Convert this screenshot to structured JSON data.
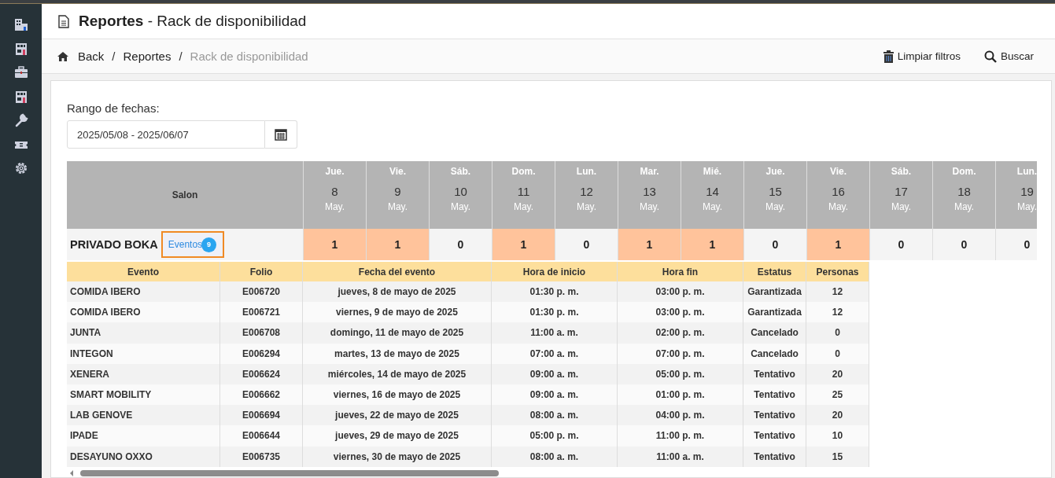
{
  "header": {
    "title_bold": "Reportes",
    "title_rest": "- Rack de disponibilidad"
  },
  "breadcrumb": {
    "items": [
      "Back",
      "Reportes",
      "Rack de disponibilidad"
    ],
    "separator": "/"
  },
  "toolbar": {
    "buttons": [
      {
        "kind": "trash",
        "label": "Limpiar filtros"
      },
      {
        "kind": "search",
        "label": "Buscar"
      }
    ]
  },
  "filter": {
    "label": "Rango de fechas:",
    "value": "2025/05/08 - 2025/06/07"
  },
  "rack": {
    "salon_header": "Salon",
    "days": [
      {
        "weekday": "Jue.",
        "day": "8",
        "month": "May."
      },
      {
        "weekday": "Vie.",
        "day": "9",
        "month": "May."
      },
      {
        "weekday": "Sáb.",
        "day": "10",
        "month": "May."
      },
      {
        "weekday": "Dom.",
        "day": "11",
        "month": "May."
      },
      {
        "weekday": "Lun.",
        "day": "12",
        "month": "May."
      },
      {
        "weekday": "Mar.",
        "day": "13",
        "month": "May."
      },
      {
        "weekday": "Mié.",
        "day": "14",
        "month": "May."
      },
      {
        "weekday": "Jue.",
        "day": "15",
        "month": "May."
      },
      {
        "weekday": "Vie.",
        "day": "16",
        "month": "May."
      },
      {
        "weekday": "Sáb.",
        "day": "17",
        "month": "May."
      },
      {
        "weekday": "Dom.",
        "day": "18",
        "month": "May."
      },
      {
        "weekday": "Lun.",
        "day": "19",
        "month": "May."
      }
    ],
    "salon": {
      "name": "PRIVADO BOKA",
      "events_button": "Eventos",
      "events_count": "9",
      "counts": [
        {
          "value": "1",
          "occupied": true
        },
        {
          "value": "1",
          "occupied": true
        },
        {
          "value": "0",
          "occupied": false
        },
        {
          "value": "1",
          "occupied": true
        },
        {
          "value": "0",
          "occupied": false
        },
        {
          "value": "1",
          "occupied": true
        },
        {
          "value": "1",
          "occupied": true
        },
        {
          "value": "0",
          "occupied": false
        },
        {
          "value": "1",
          "occupied": true
        },
        {
          "value": "0",
          "occupied": false
        },
        {
          "value": "0",
          "occupied": false
        },
        {
          "value": "0",
          "occupied": false
        }
      ]
    }
  },
  "events": {
    "columns": [
      "Evento",
      "Folio",
      "Fecha del evento",
      "Hora de inicio",
      "Hora fin",
      "Estatus",
      "Personas"
    ],
    "rows": [
      [
        "COMIDA IBERO",
        "E006720",
        "jueves, 8 de mayo de 2025",
        "01:30 p. m.",
        "03:00 p. m.",
        "Garantizada",
        "12"
      ],
      [
        "COMIDA IBERO",
        "E006721",
        "viernes, 9 de mayo de 2025",
        "01:30 p. m.",
        "03:00 p. m.",
        "Garantizada",
        "12"
      ],
      [
        "JUNTA",
        "E006708",
        "domingo, 11 de mayo de 2025",
        "11:00 a. m.",
        "02:00 p. m.",
        "Cancelado",
        "0"
      ],
      [
        "INTEGON",
        "E006294",
        "martes, 13 de mayo de 2025",
        "07:00 a. m.",
        "07:00 p. m.",
        "Cancelado",
        "0"
      ],
      [
        "XENERA",
        "E006624",
        "miércoles, 14 de mayo de 2025",
        "09:00 a. m.",
        "05:00 p. m.",
        "Tentativo",
        "20"
      ],
      [
        "SMART MOBILITY",
        "E006662",
        "viernes, 16 de mayo de 2025",
        "09:00 a. m.",
        "01:00 p. m.",
        "Tentativo",
        "25"
      ],
      [
        "LAB GENOVE",
        "E006694",
        "jueves, 22 de mayo de 2025",
        "08:00 a. m.",
        "04:00 p. m.",
        "Tentativo",
        "20"
      ],
      [
        "IPADE",
        "E006644",
        "jueves, 29 de mayo de 2025",
        "05:00 p. m.",
        "11:00 p. m.",
        "Tentativo",
        "10"
      ],
      [
        "DESAYUNO OXXO",
        "E006735",
        "viernes, 30 de mayo de 2025",
        "08:00 a. m.",
        "11:00 a. m.",
        "Tentativo",
        "15"
      ]
    ]
  }
}
